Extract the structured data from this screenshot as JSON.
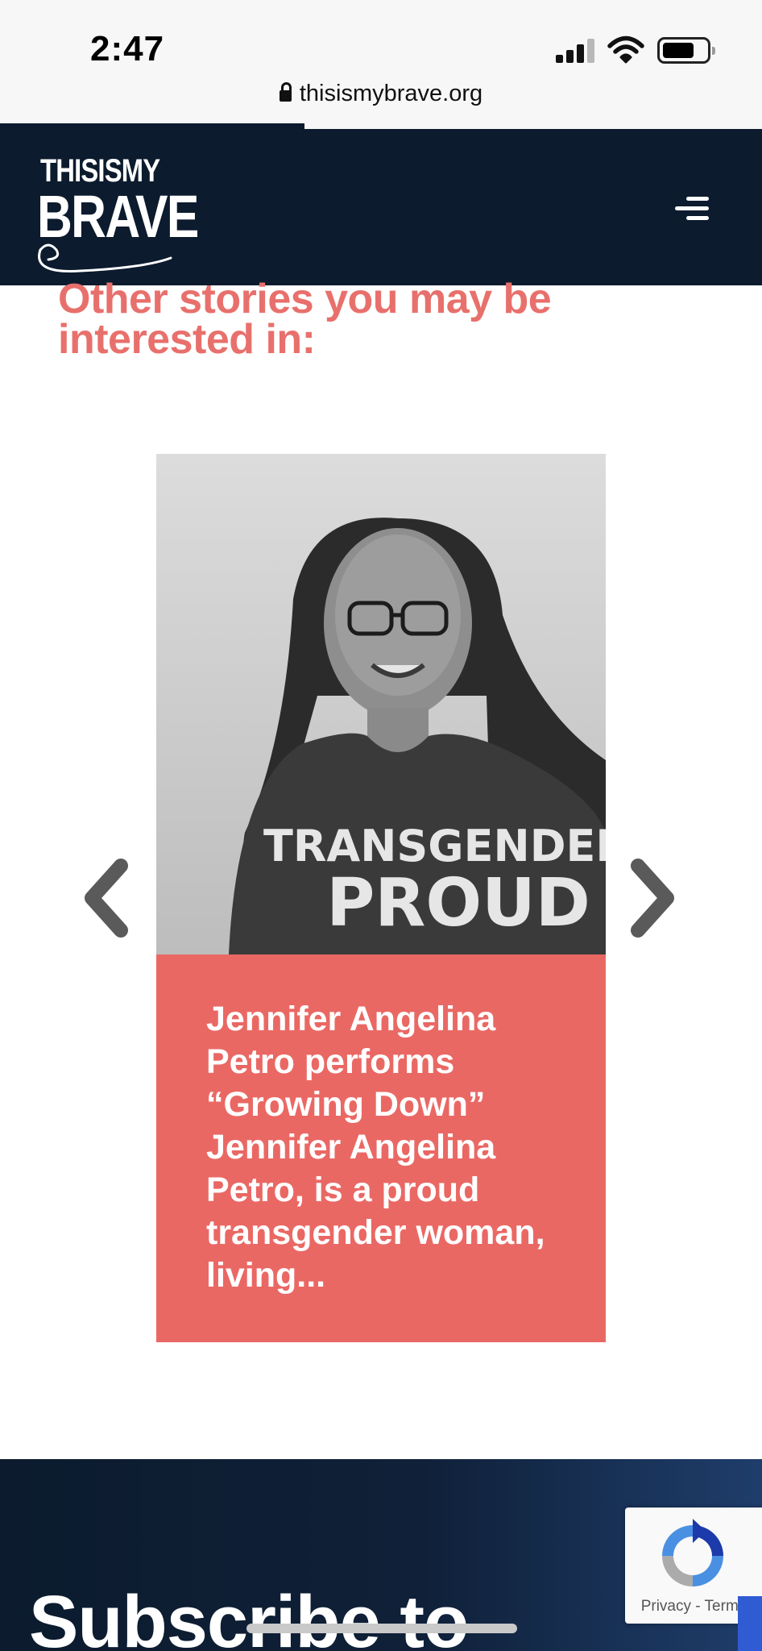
{
  "status_bar": {
    "time": "2:47",
    "url": "thisismybrave.org"
  },
  "header": {
    "logo_line1": "THISISMY",
    "logo_line2": "BRAVE",
    "menu_icon": "hamburger-menu-icon"
  },
  "section": {
    "heading": "Other stories you may be interested in:"
  },
  "carousel": {
    "prev_icon": "chevron-left-icon",
    "next_icon": "chevron-right-icon",
    "card": {
      "text": "Jennifer Angelina Petro performs “Growing Down” Jennifer Angelina Petro, is a proud transgender woman, living...",
      "shirt_line1": "TRANSGENDER",
      "shirt_line2": "PROUD"
    }
  },
  "footer": {
    "subscribe_title": "Subscribe to"
  },
  "recaptcha": {
    "privacy": "Privacy",
    "separator": "-",
    "terms": "Terms"
  },
  "colors": {
    "navy": "#0c1b2e",
    "coral": "#ea6864",
    "heading_coral": "#e8706c"
  }
}
